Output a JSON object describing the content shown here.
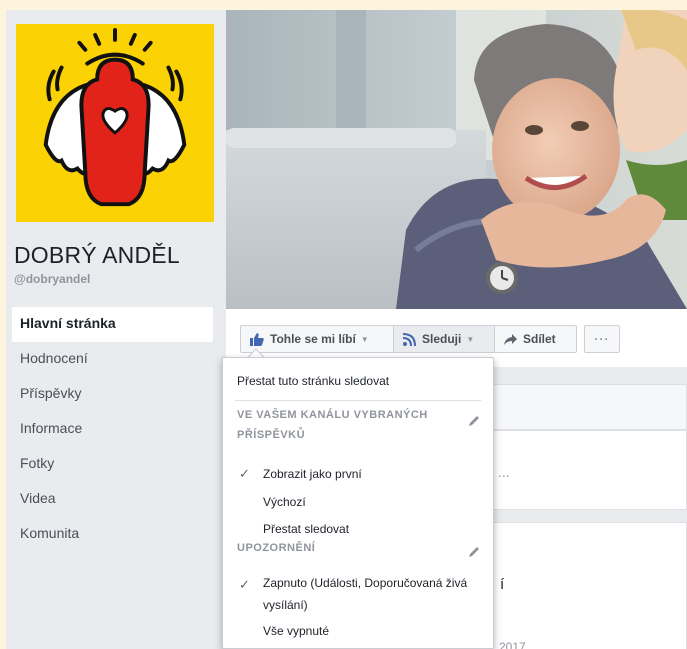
{
  "page": {
    "name": "DOBRÝ ANDĚL",
    "handle": "@dobryandel"
  },
  "sidebar": {
    "items": [
      {
        "label": "Hlavní stránka",
        "active": true
      },
      {
        "label": "Hodnocení"
      },
      {
        "label": "Příspěvky"
      },
      {
        "label": "Informace"
      },
      {
        "label": "Fotky"
      },
      {
        "label": "Videa"
      },
      {
        "label": "Komunita"
      }
    ]
  },
  "actions": {
    "like_label": "Tohle se mi líbí",
    "follow_label": "Sleduji",
    "share_label": "Sdílet",
    "more_label": "···"
  },
  "follow_menu": {
    "unfollow_page": "Přestat tuto stránku sledovat",
    "feed_heading": "VE VAŠEM KANÁLU VYBRANÝCH PŘÍSPĚVKŮ",
    "feed_options": [
      {
        "label": "Zobrazit jako první",
        "checked": true
      },
      {
        "label": "Výchozí",
        "checked": false
      },
      {
        "label": "Přestat sledovat",
        "checked": false
      }
    ],
    "notifications_heading": "UPOZORNĚNÍ",
    "notification_options": [
      {
        "label": "Zapnuto (Události, Doporučovaná živá vysílání)",
        "checked": true
      },
      {
        "label": "Vše vypnuté",
        "checked": false
      }
    ],
    "check_glyph": "✓"
  },
  "background": {
    "ellipsis": "...",
    "fragment": "í",
    "year": "2017"
  },
  "colors": {
    "logo_yellow": "#fbd203",
    "angel_red": "#e2231a",
    "like_blue": "#4267b2",
    "page_bg": "#e9ebee"
  },
  "icons": {
    "like": "thumbs-up-icon",
    "follow": "rss-icon",
    "share": "share-arrow-icon",
    "edit": "pencil-icon"
  }
}
